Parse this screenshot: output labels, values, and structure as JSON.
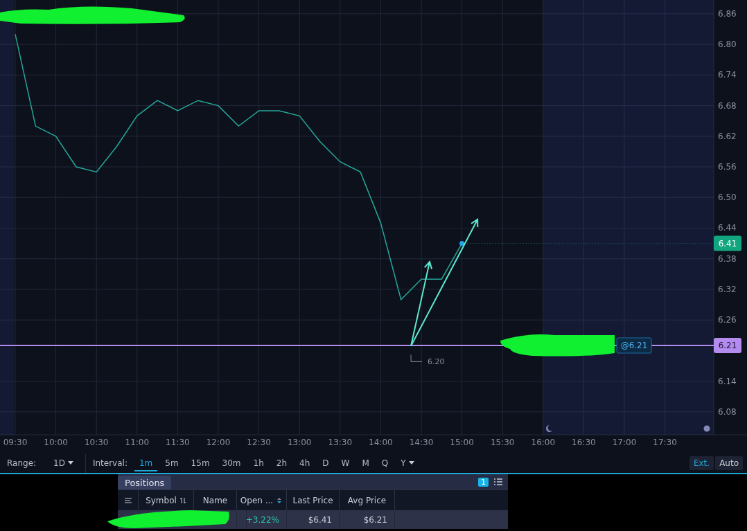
{
  "chart": {
    "chart_data": {
      "type": "line",
      "grid": true,
      "categories": [
        "09:30",
        null,
        "10:00",
        null,
        "10:30",
        null,
        "11:00",
        null,
        "11:30",
        null,
        "12:00",
        null,
        "12:30",
        null,
        "13:00",
        null,
        "13:30",
        null,
        "14:00",
        null,
        "14:30",
        null,
        "15:00",
        null,
        "15:30",
        null,
        "16:00",
        null,
        "16:30",
        null,
        "17:00",
        null,
        "17:30",
        null
      ],
      "series": [
        {
          "color": "#26a69a",
          "values": [
            6.82,
            6.64,
            6.62,
            6.56,
            6.55,
            6.6,
            6.66,
            6.69,
            6.67,
            6.69,
            6.68,
            6.64,
            6.67,
            6.67,
            6.66,
            6.61,
            6.57,
            6.55,
            6.45,
            6.3,
            6.34,
            6.34,
            6.41,
            null,
            null,
            null,
            null,
            null,
            null,
            null,
            null,
            null,
            null,
            null
          ]
        }
      ],
      "yticks": [
        {
          "value": 6.08,
          "label": "6.08"
        },
        {
          "value": 6.14,
          "label": "6.14"
        },
        {
          "value": 6.26,
          "label": "6.26"
        },
        {
          "value": 6.32,
          "label": "6.32"
        },
        {
          "value": 6.38,
          "label": "6.38"
        },
        {
          "value": 6.44,
          "label": "6.44"
        },
        {
          "value": 6.5,
          "label": "6.50"
        },
        {
          "value": 6.56,
          "label": "6.56"
        },
        {
          "value": 6.62,
          "label": "6.62"
        },
        {
          "value": 6.68,
          "label": "6.68"
        },
        {
          "value": 6.74,
          "label": "6.74"
        },
        {
          "value": 6.8,
          "label": "6.80"
        },
        {
          "value": 6.86,
          "label": "6.86"
        }
      ],
      "ylim": [
        6.035,
        6.887
      ]
    },
    "last_price_label": "6.41",
    "position_label": "6.21",
    "order_tag": "@6.21",
    "low_label": "6.20"
  },
  "toolbar": {
    "range_label": "Range:",
    "range_value": "1D",
    "interval_label": "Interval:",
    "intervals": [
      {
        "label": "1m",
        "selected": true,
        "dropdown": false
      },
      {
        "label": "5m",
        "selected": false,
        "dropdown": false
      },
      {
        "label": "15m",
        "selected": false,
        "dropdown": false
      },
      {
        "label": "30m",
        "selected": false,
        "dropdown": false
      },
      {
        "label": "1h",
        "selected": false,
        "dropdown": false
      },
      {
        "label": "2h",
        "selected": false,
        "dropdown": false
      },
      {
        "label": "4h",
        "selected": false,
        "dropdown": false
      },
      {
        "label": "D",
        "selected": false,
        "dropdown": false
      },
      {
        "label": "W",
        "selected": false,
        "dropdown": false
      },
      {
        "label": "M",
        "selected": false,
        "dropdown": false
      },
      {
        "label": "Q",
        "selected": false,
        "dropdown": false
      },
      {
        "label": "Y",
        "selected": false,
        "dropdown": true
      }
    ],
    "buttons": [
      {
        "label": "Ext.",
        "selected": true
      },
      {
        "label": "Auto",
        "selected": false
      }
    ]
  },
  "positions": {
    "tab": {
      "label": "Positions",
      "selected": true
    },
    "count": "1",
    "columns": [
      {
        "label": "Symbol",
        "kind": "sortable"
      },
      {
        "label": "Name",
        "kind": "plain"
      },
      {
        "label": "Open ...",
        "kind": "sorted"
      },
      {
        "label": "Last Price",
        "kind": "plain"
      },
      {
        "label": "Avg Price",
        "kind": "plain"
      }
    ],
    "rows": [
      {
        "open_pl": "+3.22%",
        "last_price": "$6.41",
        "avg_price": "$6.21"
      }
    ]
  }
}
